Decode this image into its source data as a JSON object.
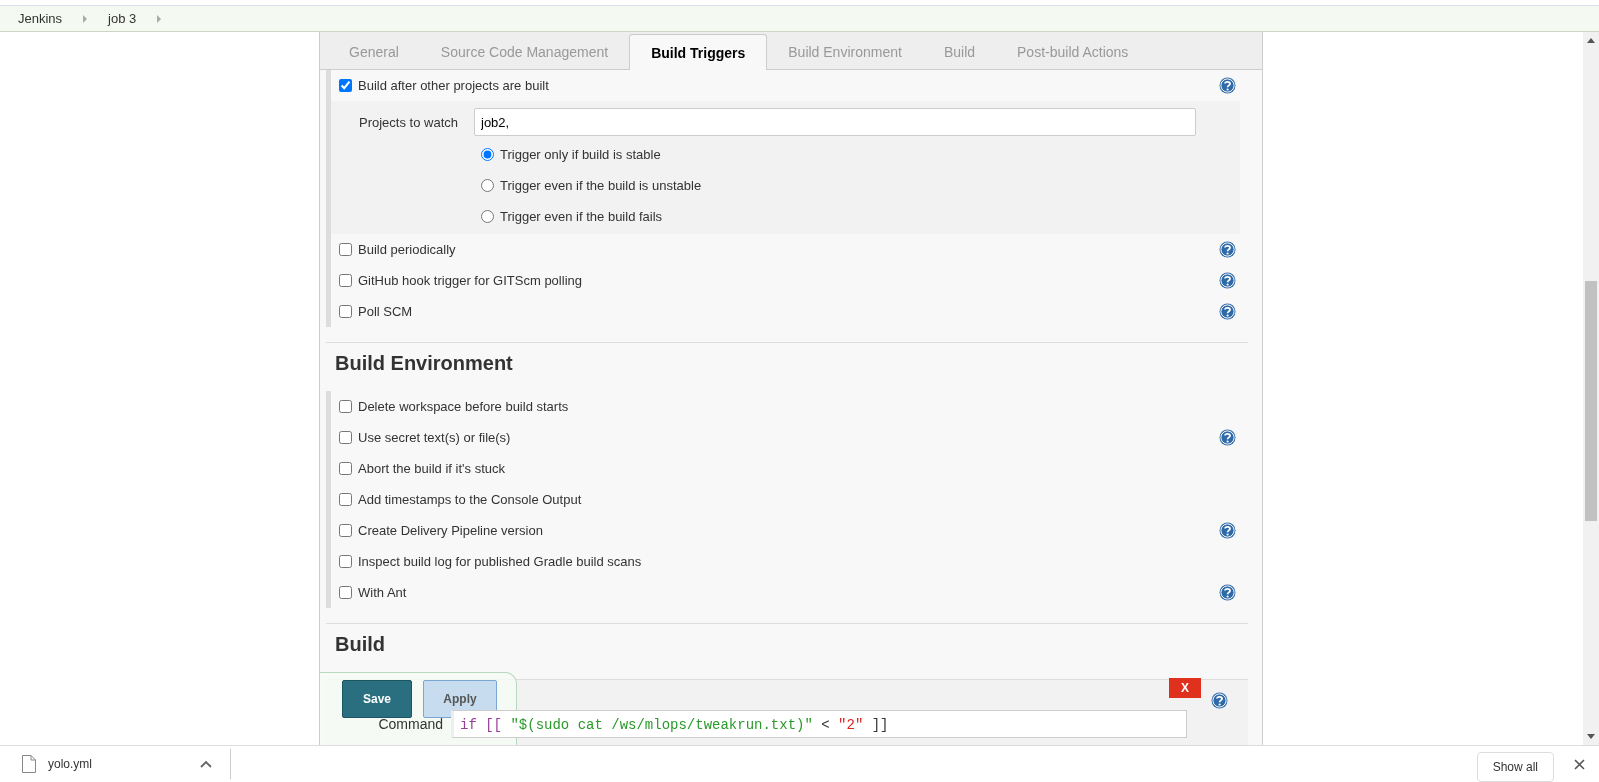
{
  "breadcrumbs": [
    "Jenkins",
    "job 3"
  ],
  "tabs": [
    {
      "label": "General",
      "selected": false
    },
    {
      "label": "Source Code Management",
      "selected": false
    },
    {
      "label": "Build Triggers",
      "selected": true
    },
    {
      "label": "Build Environment",
      "selected": false
    },
    {
      "label": "Build",
      "selected": false
    },
    {
      "label": "Post-build Actions",
      "selected": false
    }
  ],
  "triggers": [
    {
      "label": "Build after other projects are built",
      "checked": true,
      "help": true,
      "config": {
        "field_label": "Projects to watch",
        "value": "job2,",
        "radios": [
          {
            "label": "Trigger only if build is stable",
            "selected": true
          },
          {
            "label": "Trigger even if the build is unstable",
            "selected": false
          },
          {
            "label": "Trigger even if the build fails",
            "selected": false
          }
        ]
      }
    },
    {
      "label": "Build periodically",
      "checked": false,
      "help": true
    },
    {
      "label": "GitHub hook trigger for GITScm polling",
      "checked": false,
      "help": true
    },
    {
      "label": "Poll SCM",
      "checked": false,
      "help": true
    }
  ],
  "sections": [
    {
      "title": "Build Environment",
      "options": [
        {
          "label": "Delete workspace before build starts",
          "checked": false,
          "help": false
        },
        {
          "label": "Use secret text(s) or file(s)",
          "checked": false,
          "help": true
        },
        {
          "label": "Abort the build if it's stuck",
          "checked": false,
          "help": false
        },
        {
          "label": "Add timestamps to the Console Output",
          "checked": false,
          "help": false
        },
        {
          "label": "Create Delivery Pipeline version",
          "checked": false,
          "help": true
        },
        {
          "label": "Inspect build log for published Gradle build scans",
          "checked": false,
          "help": false
        },
        {
          "label": "With Ant",
          "checked": false,
          "help": true
        }
      ]
    }
  ],
  "build": {
    "title": "Build",
    "delete_button": "X",
    "command_label": "Command",
    "code": [
      {
        "text": "if [[ ",
        "kind": "keyword"
      },
      {
        "text": "\"$(sudo cat /ws/mlops/tweakrun.txt)\"",
        "kind": "string"
      },
      {
        "text": " < ",
        "kind": "plain"
      },
      {
        "text": "\"2\"",
        "kind": "number"
      },
      {
        "text": " ]]",
        "kind": "plain"
      }
    ]
  },
  "actions": {
    "save": "Save",
    "apply": "Apply"
  },
  "downloads": {
    "file": "yolo.yml",
    "show_all": "Show all"
  }
}
